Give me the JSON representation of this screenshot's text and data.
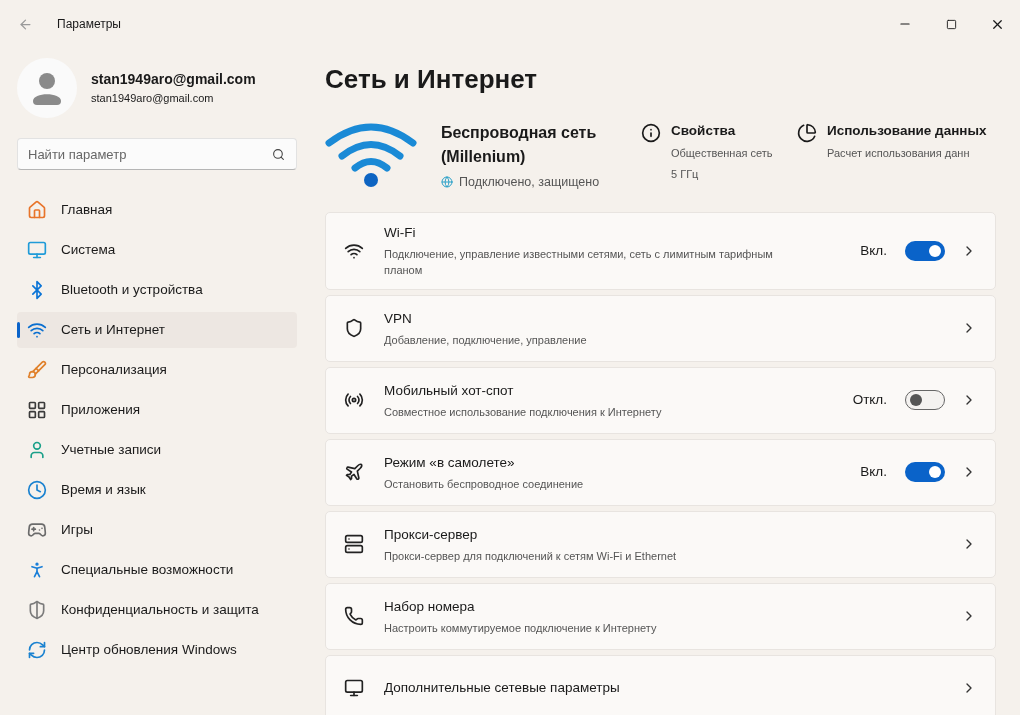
{
  "window": {
    "title": "Параметры"
  },
  "account": {
    "name": "stan1949aro@gmail.com",
    "email": "stan1949aro@gmail.com"
  },
  "search": {
    "placeholder": "Найти параметр"
  },
  "sidebar": {
    "items": [
      {
        "label": "Главная",
        "selected": false
      },
      {
        "label": "Система",
        "selected": false
      },
      {
        "label": "Bluetooth и устройства",
        "selected": false
      },
      {
        "label": "Сеть и Интернет",
        "selected": true
      },
      {
        "label": "Персонализация",
        "selected": false
      },
      {
        "label": "Приложения",
        "selected": false
      },
      {
        "label": "Учетные записи",
        "selected": false
      },
      {
        "label": "Время и язык",
        "selected": false
      },
      {
        "label": "Игры",
        "selected": false
      },
      {
        "label": "Специальные возможности",
        "selected": false
      },
      {
        "label": "Конфиденциальность и защита",
        "selected": false
      },
      {
        "label": "Центр обновления Windows",
        "selected": false
      }
    ]
  },
  "page": {
    "title": "Сеть и Интернет"
  },
  "network": {
    "name": "Беспроводная сеть (Millenium)",
    "status": "Подключено, защищено",
    "properties": {
      "title": "Свойства",
      "lines": [
        "Общественная сеть",
        "5 ГГц"
      ]
    },
    "data_usage": {
      "title": "Использование данных",
      "lines": [
        "Расчет использования данн"
      ]
    }
  },
  "cards": [
    {
      "kind": "toggle",
      "title": "Wi-Fi",
      "subtitle": "Подключение, управление известными сетями, сеть с лимитным тарифным планом",
      "state_label": "Вкл.",
      "on": true
    },
    {
      "kind": "link",
      "title": "VPN",
      "subtitle": "Добавление, подключение, управление"
    },
    {
      "kind": "toggle",
      "title": "Мобильный хот-спот",
      "subtitle": "Совместное использование подключения к Интернету",
      "state_label": "Откл.",
      "on": false
    },
    {
      "kind": "toggle",
      "title": "Режим «в самолете»",
      "subtitle": "Остановить беспроводное соединение",
      "state_label": "Вкл.",
      "on": true
    },
    {
      "kind": "link",
      "title": "Прокси-сервер",
      "subtitle": "Прокси-сервер для подключений к сетям Wi-Fi и Ethernet"
    },
    {
      "kind": "link",
      "title": "Набор номера",
      "subtitle": "Настроить коммутируемое подключение к Интернету"
    },
    {
      "kind": "link",
      "title": "Дополнительные сетевые параметры"
    }
  ]
}
